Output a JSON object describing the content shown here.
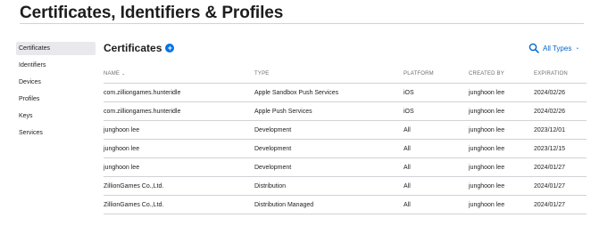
{
  "page": {
    "title": "Certificates, Identifiers & Profiles"
  },
  "sidebar": {
    "items": [
      {
        "label": "Certificates",
        "active": true
      },
      {
        "label": "Identifiers",
        "active": false
      },
      {
        "label": "Devices",
        "active": false
      },
      {
        "label": "Profiles",
        "active": false
      },
      {
        "label": "Keys",
        "active": false
      },
      {
        "label": "Services",
        "active": false
      }
    ]
  },
  "section": {
    "title": "Certificates",
    "add_icon": "plus-circle-icon",
    "search_icon": "search-icon",
    "filter_label": "All Types",
    "filter_chevron": "chevron-down-icon",
    "accent_color": "#0071e3"
  },
  "table": {
    "columns": {
      "name": "NAME",
      "type": "TYPE",
      "platform": "PLATFORM",
      "created_by": "CREATED BY",
      "expiration": "EXPIRATION"
    },
    "name_sort_icon": "chevron-down-icon",
    "rows": [
      {
        "name": "com.zilliongames.hunteridle",
        "type": "Apple Sandbox Push Services",
        "platform": "iOS",
        "created_by": "junghoon lee",
        "expiration": "2024/02/26"
      },
      {
        "name": "com.zilliongames.hunteridle",
        "type": "Apple Push Services",
        "platform": "iOS",
        "created_by": "junghoon lee",
        "expiration": "2024/02/26"
      },
      {
        "name": "junghoon lee",
        "type": "Development",
        "platform": "All",
        "created_by": "junghoon lee",
        "expiration": "2023/12/01"
      },
      {
        "name": "junghoon lee",
        "type": "Development",
        "platform": "All",
        "created_by": "junghoon lee",
        "expiration": "2023/12/15"
      },
      {
        "name": "junghoon lee",
        "type": "Development",
        "platform": "All",
        "created_by": "junghoon lee",
        "expiration": "2024/01/27"
      },
      {
        "name": "ZillionGames Co.,Ltd.",
        "type": "Distribution",
        "platform": "All",
        "created_by": "junghoon lee",
        "expiration": "2024/01/27"
      },
      {
        "name": "ZillionGames Co.,Ltd.",
        "type": "Distribution Managed",
        "platform": "All",
        "created_by": "junghoon lee",
        "expiration": "2024/01/27"
      }
    ]
  }
}
